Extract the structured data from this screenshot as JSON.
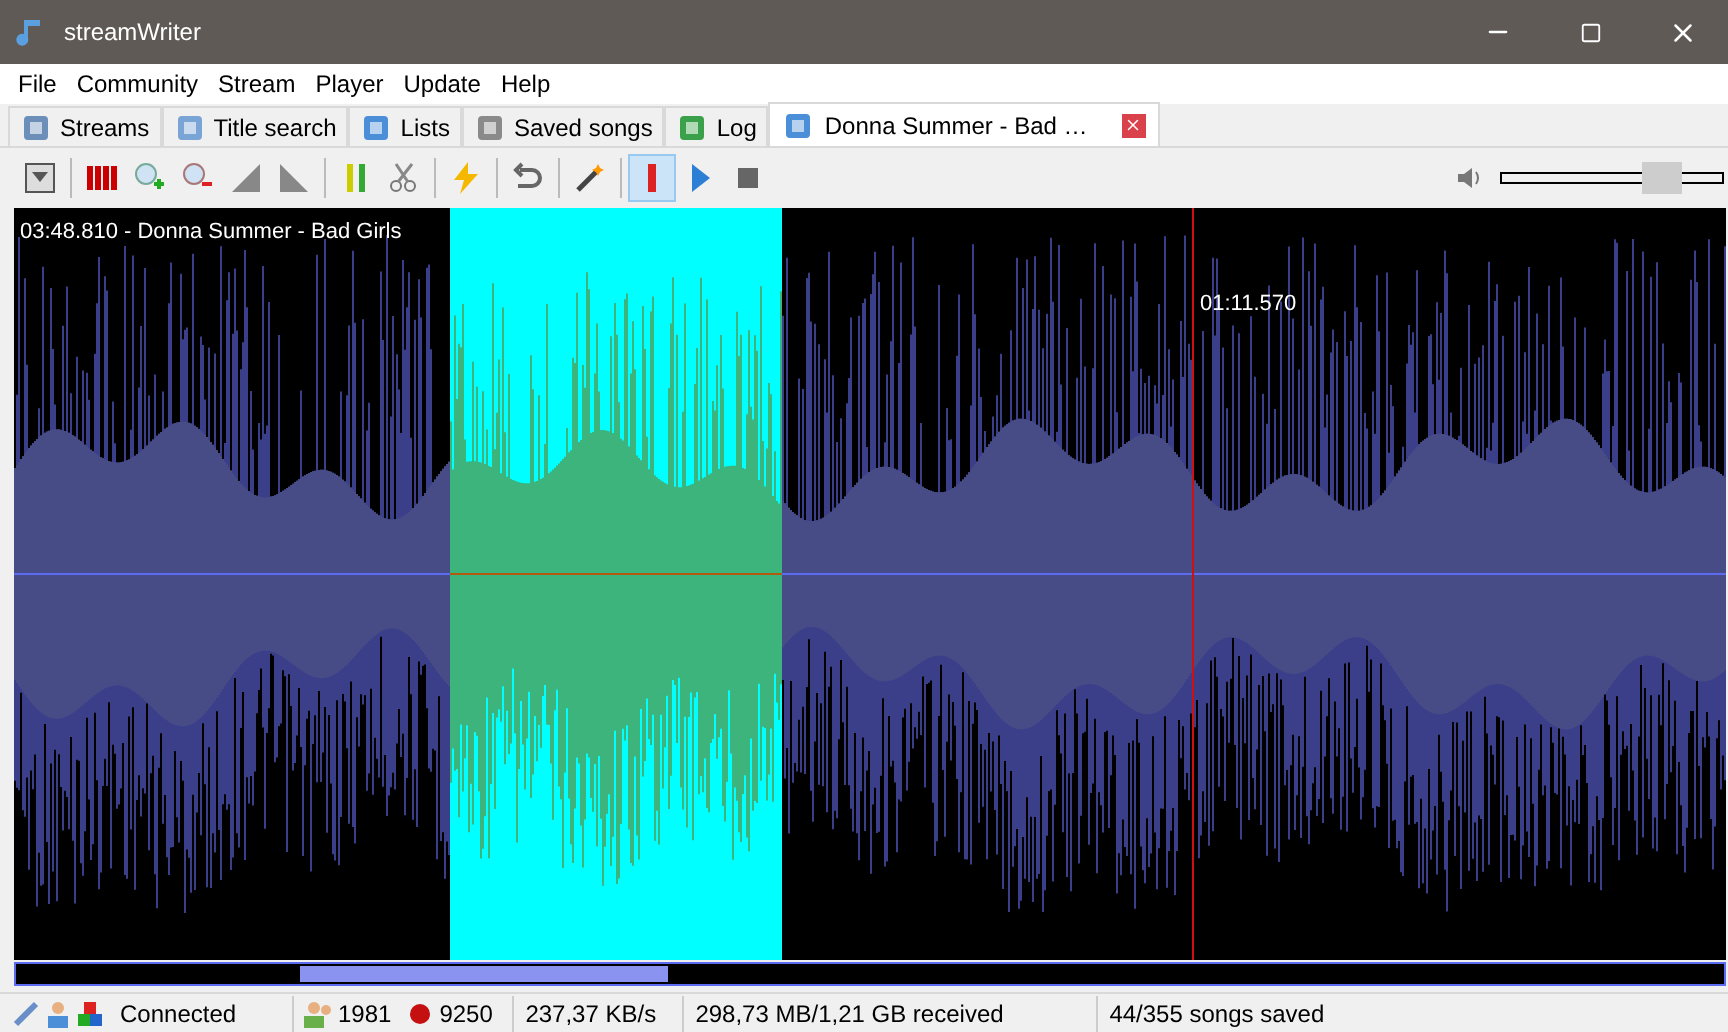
{
  "window": {
    "title": "streamWriter"
  },
  "menu": [
    "File",
    "Community",
    "Stream",
    "Player",
    "Update",
    "Help"
  ],
  "tabs": [
    {
      "label": "Streams",
      "selected": false,
      "closable": false
    },
    {
      "label": "Title search",
      "selected": false,
      "closable": false
    },
    {
      "label": "Lists",
      "selected": false,
      "closable": false
    },
    {
      "label": "Saved songs",
      "selected": false,
      "closable": false
    },
    {
      "label": "Log",
      "selected": false,
      "closable": false
    },
    {
      "label": "Donna Summer - Bad …",
      "selected": true,
      "closable": true
    }
  ],
  "toolbar": [
    {
      "pressed": false
    },
    {
      "pressed": false
    },
    {
      "pressed": false
    },
    {
      "pressed": false
    },
    {
      "pressed": false
    },
    {
      "pressed": false
    },
    {
      "pressed": false
    },
    {
      "pressed": false
    },
    {
      "pressed": false
    },
    {
      "pressed": false
    },
    {
      "pressed": false
    },
    {
      "pressed": true
    },
    {
      "pressed": false
    },
    {
      "pressed": false
    }
  ],
  "volume": {
    "level": 0.72
  },
  "waveform": {
    "title": "03:48.810 - Donna Summer - Bad Girls",
    "cursor_time": "01:11.570"
  },
  "status_bar": {
    "connection": "Connected",
    "listeners": "1981",
    "recordings": "9250",
    "speed": "237,37 KB/s",
    "received": "298,73 MB/1,21 GB received",
    "saved": "44/355 songs saved"
  }
}
